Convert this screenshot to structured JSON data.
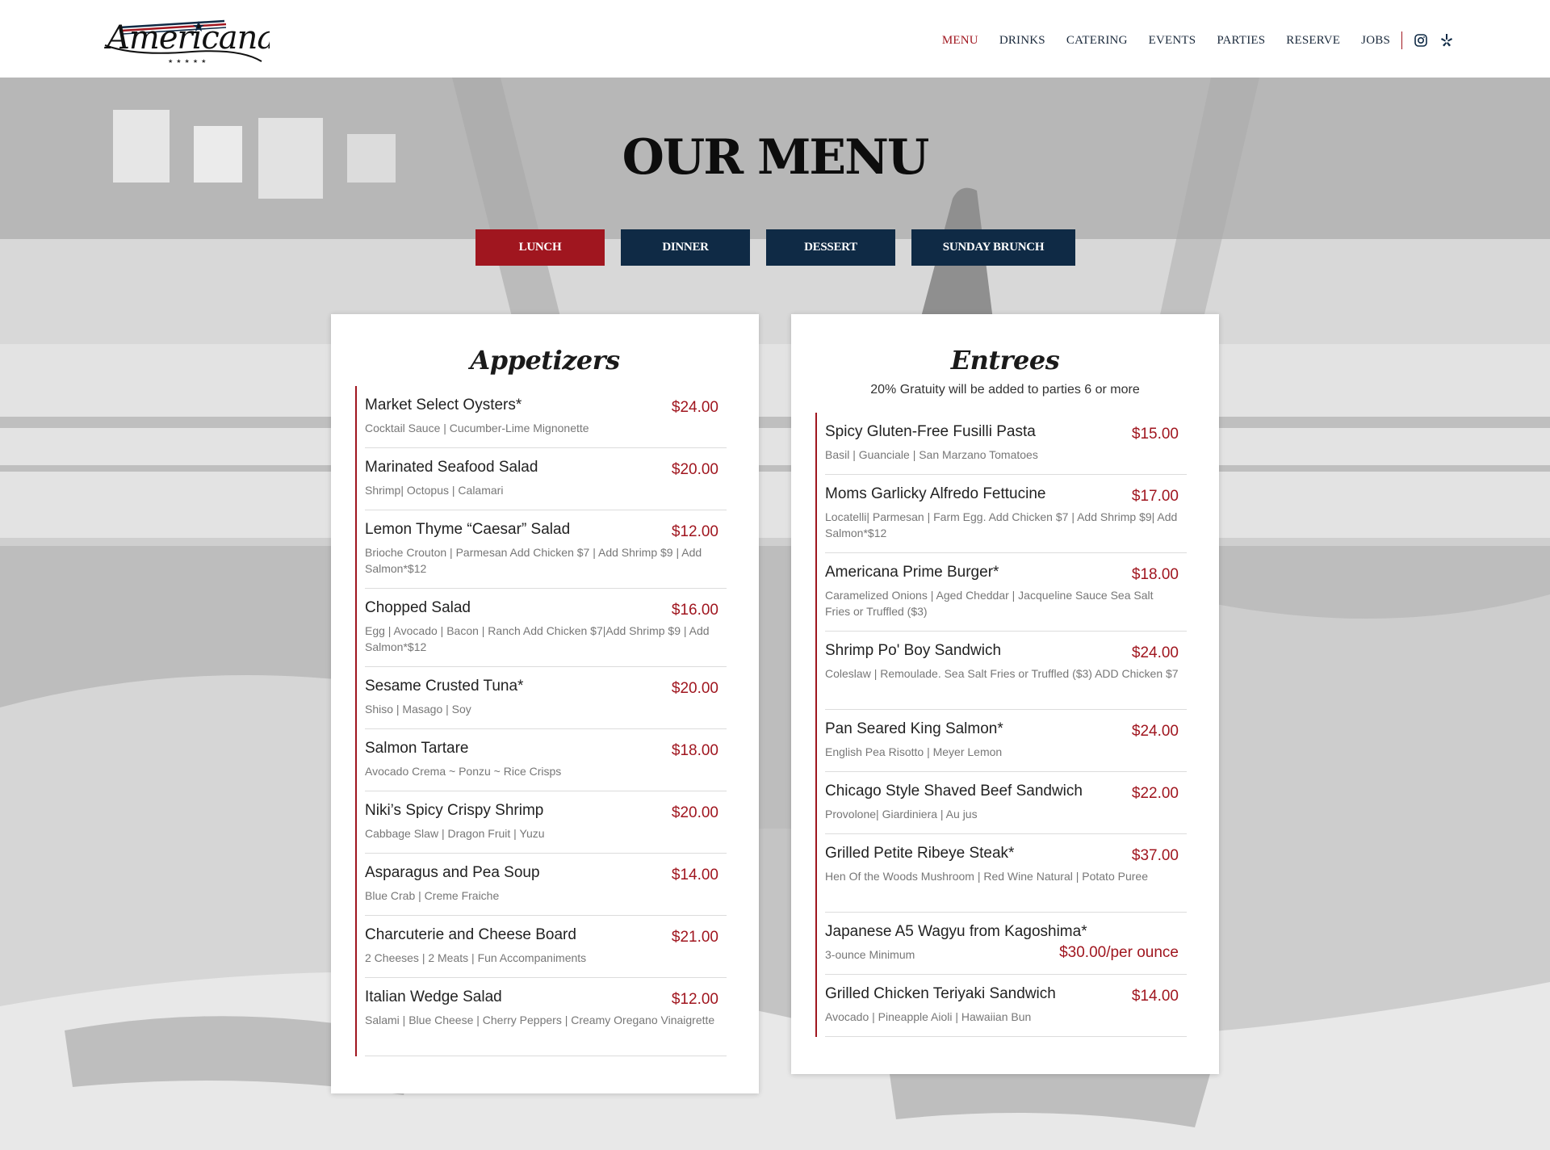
{
  "header": {
    "logo_text": "Americana",
    "nav": [
      {
        "label": "MENU",
        "active": true
      },
      {
        "label": "DRINKS",
        "active": false
      },
      {
        "label": "CATERING",
        "active": false
      },
      {
        "label": "EVENTS",
        "active": false
      },
      {
        "label": "PARTIES",
        "active": false
      },
      {
        "label": "RESERVE",
        "active": false
      },
      {
        "label": "JOBS",
        "active": false
      }
    ],
    "social_icons": [
      "instagram-icon",
      "yelp-icon"
    ]
  },
  "main": {
    "title": "OUR MENU",
    "tabs": [
      {
        "label": "LUNCH",
        "active": true
      },
      {
        "label": "DINNER",
        "active": false
      },
      {
        "label": "DESSERT",
        "active": false
      },
      {
        "label": "SUNDAY BRUNCH",
        "active": false
      }
    ]
  },
  "appetizers": {
    "heading": "Appetizers",
    "items": [
      {
        "name": "Market Select Oysters*",
        "price": "$24.00",
        "desc": "Cocktail Sauce | Cucumber-Lime Mignonette"
      },
      {
        "name": "Marinated Seafood Salad",
        "price": "$20.00",
        "desc": "Shrimp| Octopus | Calamari"
      },
      {
        "name": "Lemon Thyme “Caesar” Salad",
        "price": "$12.00",
        "desc": "Brioche Crouton | Parmesan Add Chicken $7 | Add Shrimp $9 | Add Salmon*$12"
      },
      {
        "name": "Chopped Salad",
        "price": "$16.00",
        "desc": "Egg | Avocado | Bacon | Ranch Add Chicken $7|Add Shrimp $9 | Add Salmon*$12"
      },
      {
        "name": "Sesame Crusted Tuna*",
        "price": "$20.00",
        "desc": "Shiso | Masago | Soy"
      },
      {
        "name": "Salmon Tartare",
        "price": "$18.00",
        "desc": "Avocado Crema ~ Ponzu ~ Rice Crisps"
      },
      {
        "name": "Niki’s Spicy Crispy Shrimp",
        "price": "$20.00",
        "desc": "Cabbage Slaw | Dragon Fruit | Yuzu"
      },
      {
        "name": "Asparagus and Pea Soup",
        "price": "$14.00",
        "desc": "Blue Crab | Creme Fraiche"
      },
      {
        "name": "Charcuterie and Cheese Board",
        "price": "$21.00",
        "desc": "2 Cheeses | 2 Meats | Fun Accompaniments"
      },
      {
        "name": "Italian Wedge Salad",
        "price": "$12.00",
        "desc": "Salami | Blue Cheese | Cherry Peppers | Creamy Oregano Vinaigrette"
      }
    ]
  },
  "entrees": {
    "heading": "Entrees",
    "note": "20% Gratuity will be added to parties 6 or more",
    "items": [
      {
        "name": "Spicy Gluten-Free Fusilli Pasta",
        "price": "$15.00",
        "desc": "Basil | Guanciale | San Marzano Tomatoes"
      },
      {
        "name": "Moms Garlicky Alfredo Fettucine",
        "price": "$17.00",
        "desc": "Locatelli| Parmesan | Farm Egg. Add Chicken $7 | Add Shrimp $9| Add Salmon*$12"
      },
      {
        "name": "Americana Prime Burger*",
        "price": "$18.00",
        "desc": "Caramelized Onions | Aged Cheddar | Jacqueline Sauce Sea Salt Fries or Truffled ($3)"
      },
      {
        "name": "Shrimp Po' Boy Sandwich",
        "price": "$24.00",
        "desc": "Coleslaw | Remoulade. Sea Salt Fries or Truffled ($3) ADD Chicken $7"
      },
      {
        "name": "Pan Seared King Salmon*",
        "price": "$24.00",
        "desc": "English Pea Risotto | Meyer Lemon"
      },
      {
        "name": "Chicago Style Shaved Beef Sandwich",
        "price": "$22.00",
        "desc": "Provolone| Giardiniera | Au jus"
      },
      {
        "name": "Grilled Petite Ribeye Steak*",
        "price": "$37.00",
        "desc": "Hen Of the Woods Mushroom | Red Wine Natural | Potato Puree"
      },
      {
        "name": "Japanese A5 Wagyu from Kagoshima*",
        "price": "$30.00/per ounce",
        "desc": "3-ounce Minimum"
      },
      {
        "name": "Grilled Chicken Teriyaki Sandwich",
        "price": "$14.00",
        "desc": "Avocado | Pineapple Aioli | Hawaiian Bun"
      }
    ]
  },
  "colors": {
    "accent_red": "#a0161f",
    "navy": "#0f2a45"
  }
}
